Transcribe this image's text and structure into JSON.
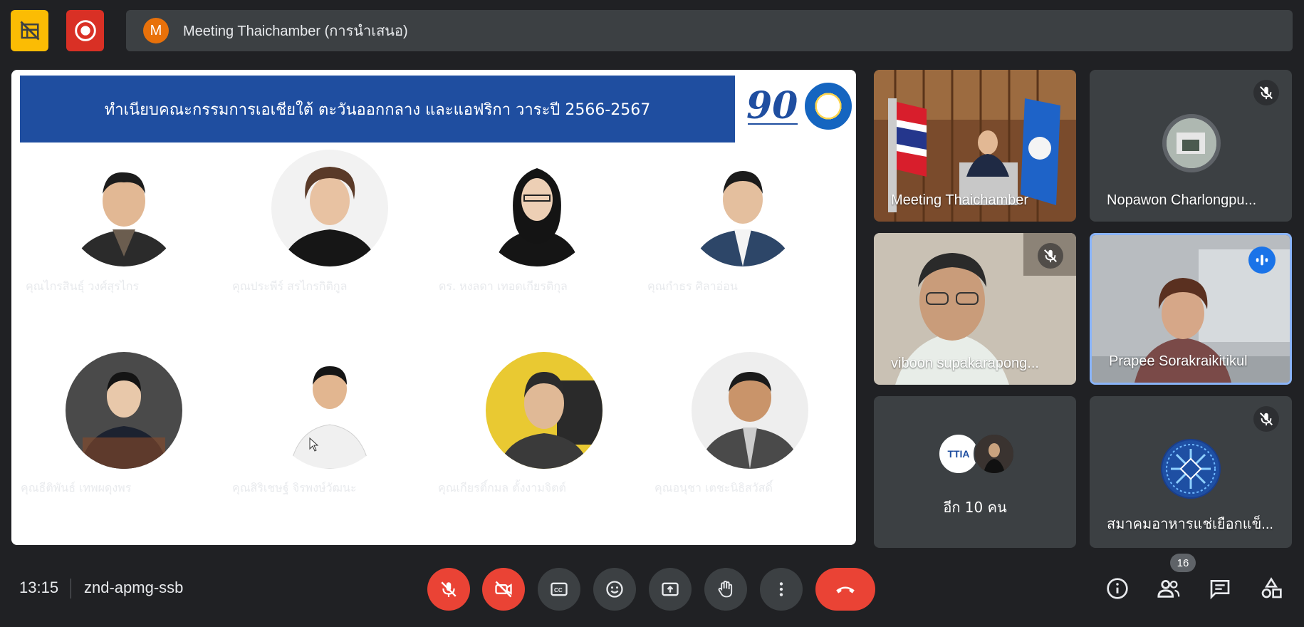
{
  "top_bar": {
    "meeting_title": "Meeting Thaichamber (การนำเสนอ)",
    "avatar_letter": "M"
  },
  "slide": {
    "banner": "ทำเนียบคณะกรรมการเอเชียใต้ ตะวันออกกลาง และแอฟริกา วาระปี 2566-2567",
    "logo_number": "90",
    "members": [
      {
        "name": "คุณไกรสินธุ์ วงศ์สุรไกร"
      },
      {
        "name": "คุณประพีร์ สรไกรกิติกูล"
      },
      {
        "name": "ดร. หงลดา เทอดเกียรติกุล"
      },
      {
        "name": "คุณกำธร ศิลาอ่อน"
      },
      {
        "name": "คุณธีติพันธ์ เทพผดุงพร"
      },
      {
        "name": "คุณสิริเชษฐ์ จิรพงษ์วัฒนะ"
      },
      {
        "name": "คุณเกียรติ์กมล ตั้งงามจิตต์"
      },
      {
        "name": "คุณอนุชา เตชะนิธิสวัสดิ์"
      }
    ]
  },
  "participants": [
    {
      "name": "Meeting Thaichamber",
      "muted": false
    },
    {
      "name": "Nopawon Charlongpu...",
      "muted": true
    },
    {
      "name": "viboon supakarapong...",
      "muted": true
    },
    {
      "name": "Prapee Sorakraikitikul",
      "speaking": true
    },
    {
      "name": "อีก 10 คน",
      "logo_text": "TTIA"
    },
    {
      "name": "สมาคมอาหารแช่เยือกแข็...",
      "muted": true
    }
  ],
  "bottom_bar": {
    "time": "13:15",
    "meeting_code": "znd-apmg-ssb",
    "people_count": "16"
  },
  "colors": {
    "background": "#202124",
    "tile": "#3c4043",
    "danger": "#ea4335",
    "banner": "#1f4ea0",
    "active_border": "#8ab4f8"
  }
}
